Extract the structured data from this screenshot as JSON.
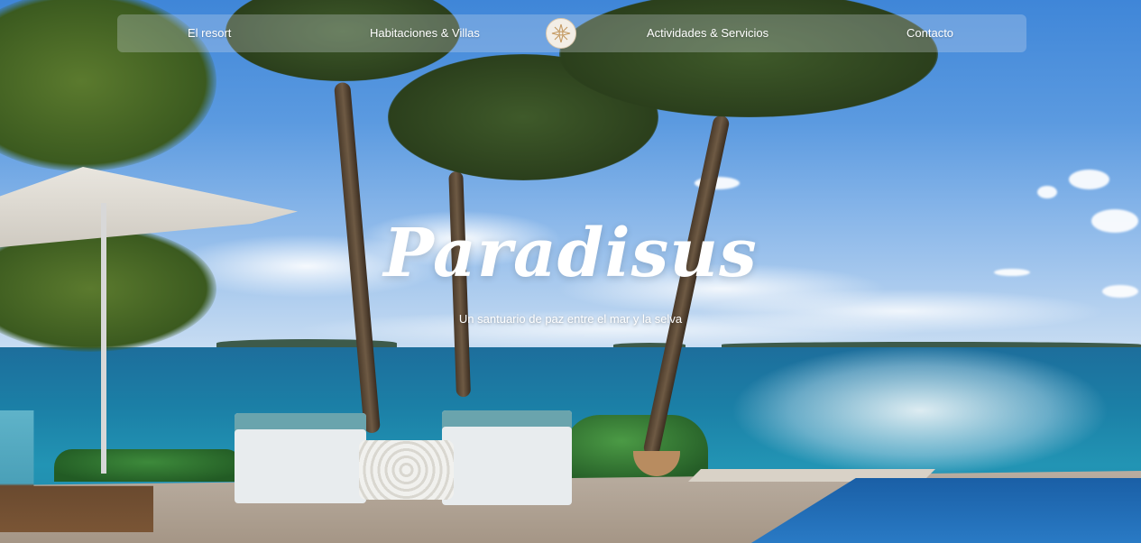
{
  "nav": {
    "items": [
      {
        "label": "El resort"
      },
      {
        "label": "Habitaciones & Villas"
      },
      {
        "label": "Actividades & Servicios"
      },
      {
        "label": "Contacto"
      }
    ],
    "logo_icon": "compass-rose-icon"
  },
  "hero": {
    "title": "Paradisus",
    "subtitle": "Un santuario de paz entre el mar y la selva"
  },
  "colors": {
    "nav_bg": "rgba(220,228,240,0.28)",
    "text": "#ffffff",
    "sea": "#1b7fa6",
    "sky": "#5b9ae0"
  }
}
